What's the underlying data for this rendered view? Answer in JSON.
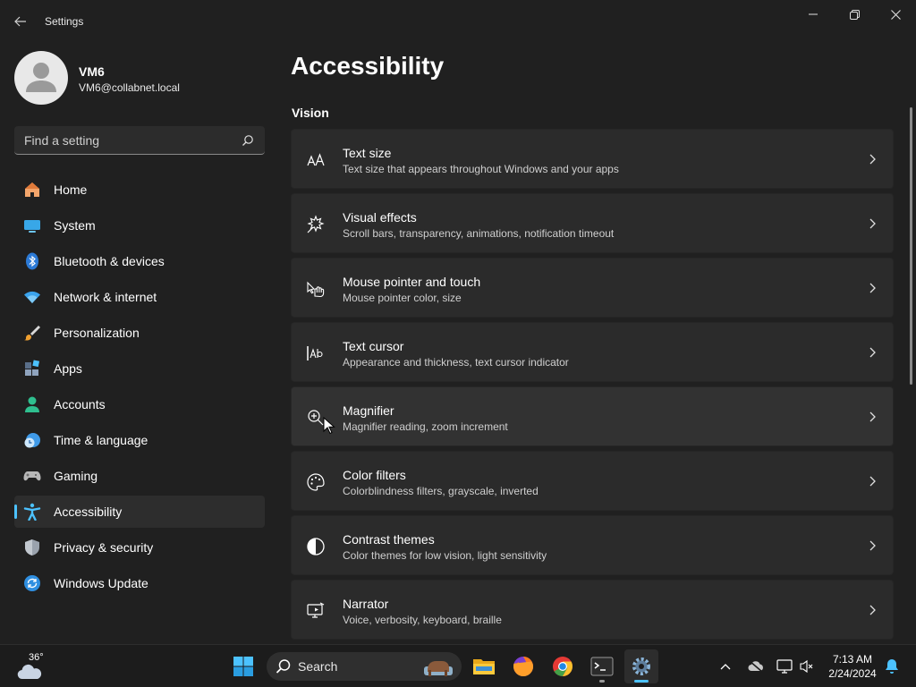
{
  "window": {
    "title": "Settings"
  },
  "profile": {
    "name": "VM6",
    "email": "VM6@collabnet.local"
  },
  "search": {
    "placeholder": "Find a setting"
  },
  "sidebar": {
    "items": [
      {
        "label": "Home",
        "icon": "home-icon"
      },
      {
        "label": "System",
        "icon": "system-icon"
      },
      {
        "label": "Bluetooth & devices",
        "icon": "bluetooth-icon"
      },
      {
        "label": "Network & internet",
        "icon": "wifi-icon"
      },
      {
        "label": "Personalization",
        "icon": "brush-icon"
      },
      {
        "label": "Apps",
        "icon": "apps-icon"
      },
      {
        "label": "Accounts",
        "icon": "accounts-icon"
      },
      {
        "label": "Time & language",
        "icon": "clock-globe-icon"
      },
      {
        "label": "Gaming",
        "icon": "gamepad-icon"
      },
      {
        "label": "Accessibility",
        "icon": "accessibility-icon",
        "active": true
      },
      {
        "label": "Privacy & security",
        "icon": "shield-icon"
      },
      {
        "label": "Windows Update",
        "icon": "update-icon"
      }
    ]
  },
  "main": {
    "title": "Accessibility",
    "section": "Vision",
    "cards": [
      {
        "title": "Text size",
        "desc": "Text size that appears throughout Windows and your apps",
        "icon": "text-size-icon"
      },
      {
        "title": "Visual effects",
        "desc": "Scroll bars, transparency, animations, notification timeout",
        "icon": "visual-effects-icon"
      },
      {
        "title": "Mouse pointer and touch",
        "desc": "Mouse pointer color, size",
        "icon": "mouse-pointer-icon"
      },
      {
        "title": "Text cursor",
        "desc": "Appearance and thickness, text cursor indicator",
        "icon": "text-cursor-icon"
      },
      {
        "title": "Magnifier",
        "desc": "Magnifier reading, zoom increment",
        "icon": "magnifier-icon"
      },
      {
        "title": "Color filters",
        "desc": "Colorblindness filters, grayscale, inverted",
        "icon": "palette-icon"
      },
      {
        "title": "Contrast themes",
        "desc": "Color themes for low vision, light sensitivity",
        "icon": "contrast-icon"
      },
      {
        "title": "Narrator",
        "desc": "Voice, verbosity, keyboard, braille",
        "icon": "narrator-icon"
      }
    ]
  },
  "taskbar": {
    "weather_temp": "36°",
    "search_label": "Search",
    "apps": [
      "start-icon",
      "file-explorer-icon",
      "firefox-icon",
      "chrome-icon",
      "terminal-icon",
      "settings-icon"
    ],
    "time": "7:13 AM",
    "date": "2/24/2024"
  },
  "colors": {
    "accent": "#4cc2ff",
    "background": "#202020",
    "card": "#2b2b2b"
  }
}
